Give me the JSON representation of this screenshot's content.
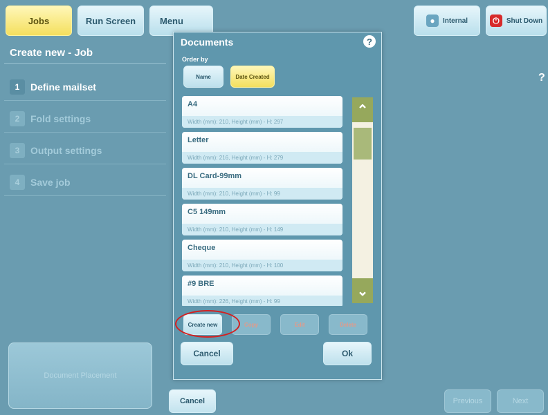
{
  "topbar": {
    "jobs": "Jobs",
    "run_screen": "Run Screen",
    "menu": "Menu",
    "internal": "Internal",
    "shut_down": "Shut Down"
  },
  "left": {
    "title": "Create new - Job",
    "steps": [
      {
        "num": "1",
        "label": "Define mailset"
      },
      {
        "num": "2",
        "label": "Fold settings"
      },
      {
        "num": "3",
        "label": "Output settings"
      },
      {
        "num": "4",
        "label": "Save job"
      }
    ],
    "doc_placement": "Document Placement"
  },
  "main": {
    "help": "?",
    "cancel": "Cancel",
    "previous": "Previous",
    "next": "Next"
  },
  "dialog": {
    "title": "Documents",
    "help": "?",
    "order_by": "Order by",
    "order_name": "Name",
    "order_date": "Date Created",
    "documents": [
      {
        "name": "A4",
        "dims": "Width (mm): 210, Height (mm) - H: 297"
      },
      {
        "name": "Letter",
        "dims": "Width (mm): 216, Height (mm) - H: 279"
      },
      {
        "name": "DL Card-99mm",
        "dims": "Width (mm): 210, Height (mm) - H: 99"
      },
      {
        "name": "C5 149mm",
        "dims": "Width (mm): 210, Height (mm) - H: 149"
      },
      {
        "name": "Cheque",
        "dims": "Width (mm): 210, Height (mm) - H: 100"
      },
      {
        "name": "#9 BRE",
        "dims": "Width (mm): 226, Height (mm) - H: 99"
      }
    ],
    "create_new": "Create new",
    "copy": "Copy",
    "edit": "Edit",
    "delete": "Delete",
    "cancel": "Cancel",
    "ok": "Ok"
  }
}
